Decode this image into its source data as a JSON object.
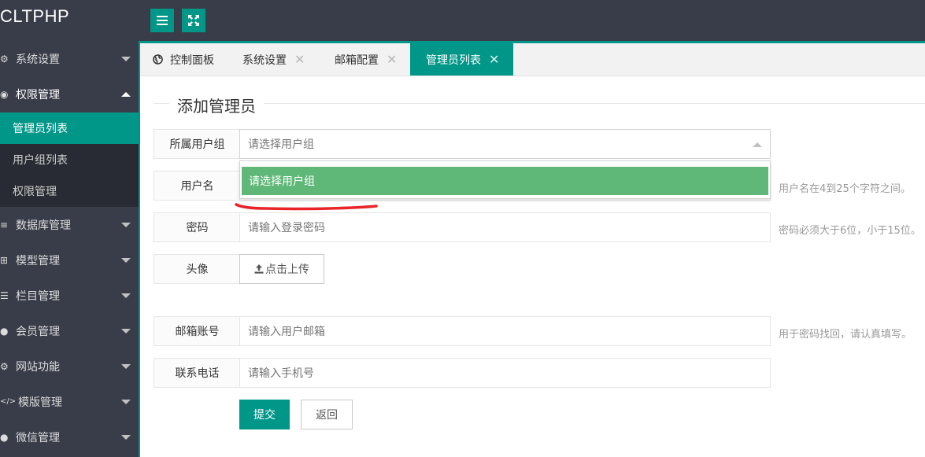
{
  "app": {
    "logo": "CLTPHP"
  },
  "topbar": {
    "menu_toggle_icon": "hamburger-icon",
    "fullscreen_icon": "fullscreen-icon"
  },
  "sidebar": {
    "menus": [
      {
        "label": "系统设置",
        "icon": "gear-key-icon",
        "expanded": false
      },
      {
        "label": "权限管理",
        "icon": "globe-icon",
        "expanded": true
      },
      {
        "label": "数据库管理",
        "icon": "database-icon",
        "expanded": false
      },
      {
        "label": "模型管理",
        "icon": "grid-icon",
        "expanded": false
      },
      {
        "label": "栏目管理",
        "icon": "list-icon",
        "expanded": false
      },
      {
        "label": "会员管理",
        "icon": "user-icon",
        "expanded": false
      },
      {
        "label": "网站功能",
        "icon": "gear-icon",
        "expanded": false
      },
      {
        "label": "模版管理",
        "icon": "code-icon",
        "expanded": false
      },
      {
        "label": "微信管理",
        "icon": "chat-icon",
        "expanded": false
      }
    ],
    "submenu": [
      {
        "label": "管理员列表",
        "active": true
      },
      {
        "label": "用户组列表",
        "active": false
      },
      {
        "label": "权限管理",
        "active": false
      }
    ]
  },
  "tabs": [
    {
      "label": "控制面板",
      "icon": "globe-icon",
      "closable": false,
      "active": false
    },
    {
      "label": "系统设置",
      "closable": true,
      "active": false
    },
    {
      "label": "邮箱配置",
      "closable": true,
      "active": false
    },
    {
      "label": "管理员列表",
      "closable": true,
      "active": true
    }
  ],
  "form": {
    "legend": "添加管理员",
    "group": {
      "label": "所属用户组",
      "placeholder": "请选择用户组",
      "dropdown_open": true,
      "options": [
        "请选择用户组"
      ]
    },
    "username": {
      "label": "用户名",
      "hint": "用户名在4到25个字符之间。"
    },
    "password": {
      "label": "密码",
      "placeholder": "请输入登录密码",
      "hint": "密码必须大于6位，小于15位。"
    },
    "avatar": {
      "label": "头像",
      "button": "点击上传",
      "icon": "upload-icon"
    },
    "email": {
      "label": "邮箱账号",
      "placeholder": "请输入用户邮箱",
      "hint": "用于密码找回，请认真填写。"
    },
    "phone": {
      "label": "联系电话",
      "placeholder": "请输入手机号"
    },
    "submit": "提交",
    "back": "返回"
  },
  "colors": {
    "accent": "#009688",
    "sidebar": "#393d49",
    "submenu_bg": "#282b33",
    "option_selected": "#5fb878",
    "annotation": "#e8262a"
  }
}
